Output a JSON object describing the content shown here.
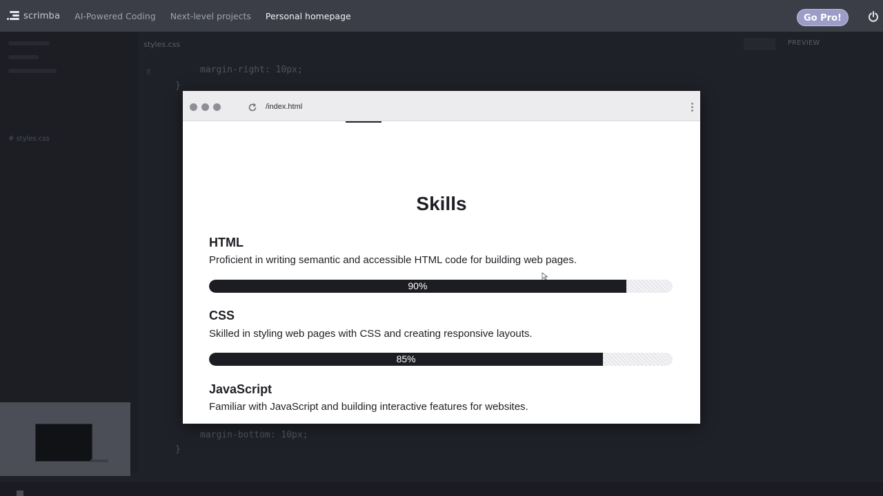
{
  "topbar": {
    "brand": "scrimba",
    "nav": [
      "AI-Powered Coding",
      "Next-level projects",
      "Personal homepage"
    ],
    "active_nav": "Personal homepage",
    "cta": "Go Pro!"
  },
  "editor": {
    "tab_label": "styles.css",
    "buttons": [
      "PREVIEW"
    ],
    "sidebar_files": [
      "styles.css"
    ],
    "code_lines": [
      "margin-right: 10px;",
      "}",
      "margin-bottom: 10px;",
      "}"
    ]
  },
  "preview": {
    "url": "/index.html",
    "section_title": "Skills",
    "skills": [
      {
        "name": "HTML",
        "description": "Proficient in writing semantic and accessible HTML code for building web pages.",
        "level": 0.9,
        "level_label": "90%"
      },
      {
        "name": "CSS",
        "description": "Skilled in styling web pages with CSS and creating responsive layouts.",
        "level": 0.85,
        "level_label": "85%"
      },
      {
        "name": "JavaScript",
        "description": "Familiar with JavaScript and building interactive features for websites."
      }
    ]
  },
  "colors": {
    "topbar": "#3b3e47",
    "gopro": "#9d9cc8",
    "bar_fill": "#1c1d22",
    "background": "#1f2128"
  }
}
